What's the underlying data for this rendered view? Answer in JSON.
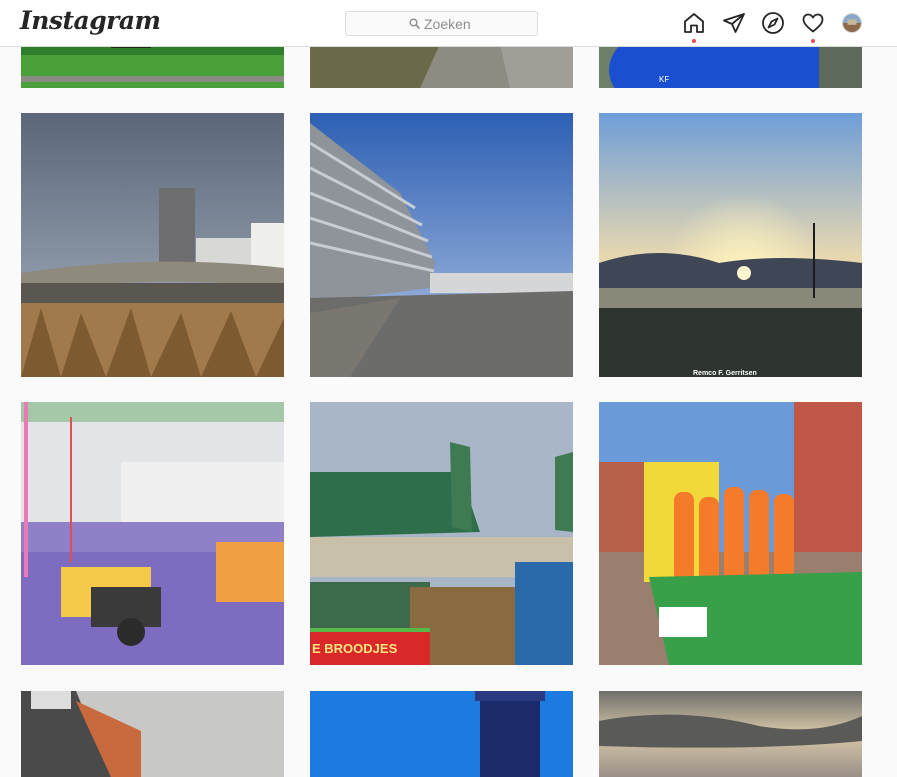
{
  "header": {
    "logo_text": "Instagram",
    "search": {
      "placeholder": "Zoeken",
      "value": ""
    },
    "nav": [
      {
        "name": "home-icon",
        "has_notification_dot": true
      },
      {
        "name": "direct-messages-icon",
        "has_notification_dot": false
      },
      {
        "name": "explore-compass-icon",
        "has_notification_dot": false
      },
      {
        "name": "activity-heart-icon",
        "has_notification_dot": true
      },
      {
        "name": "profile-avatar",
        "has_notification_dot": false
      }
    ],
    "notification_color": "#ed4956"
  },
  "feed": {
    "rows": [
      [
        "Grass field with path",
        "Shadowed pavement and grass",
        "Person in blue shirt"
      ],
      [
        "Stormy sky over apartment tower and bridge",
        "Modern apartment block along street",
        "Sunset over lake"
      ],
      [
        "Fairground kiddie ride with motorcycles",
        "Beach bar with Palm flags",
        "Orange inflatable bouncy castle"
      ],
      [
        "Brick building corner",
        "Blue tower at night sky",
        "Cloudy sunset sky"
      ]
    ],
    "photo_caption": "Remco F. Gerritsen",
    "shop_sign": "E BROODJES"
  }
}
